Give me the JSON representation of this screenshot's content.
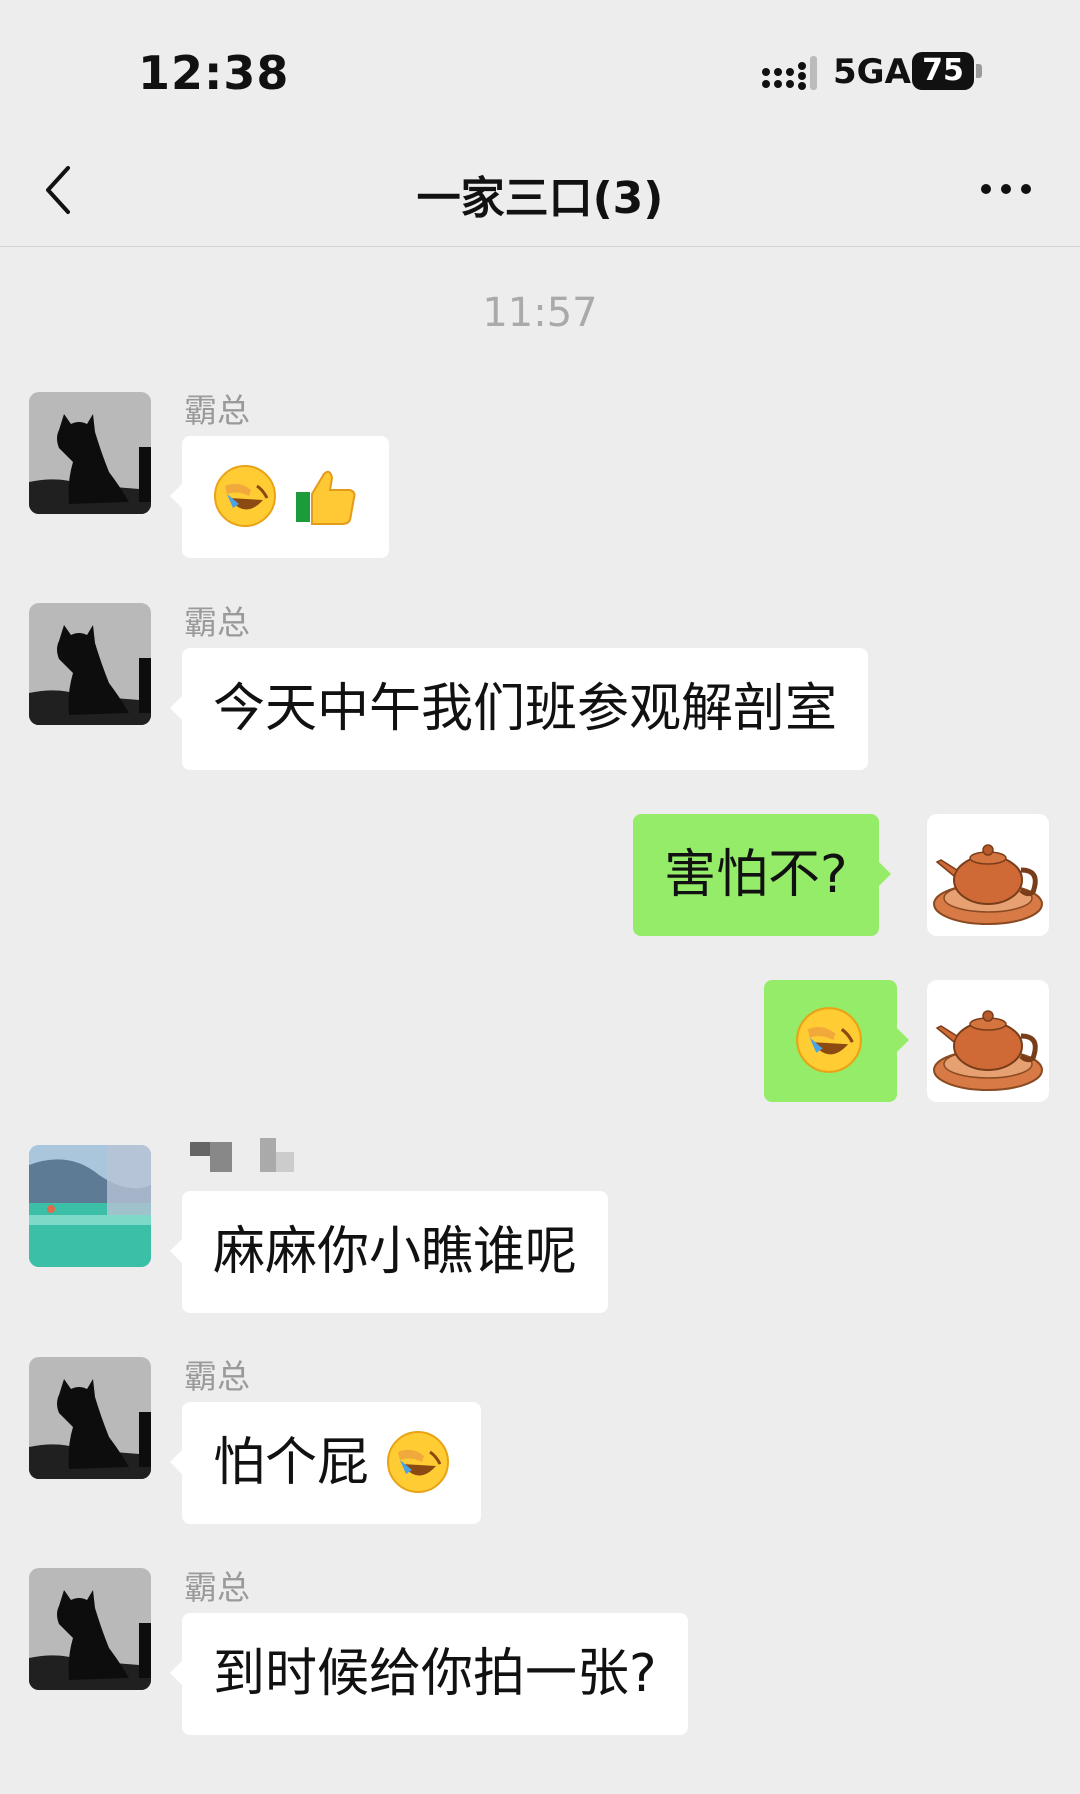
{
  "status_bar": {
    "time": "12:38",
    "network": "5GA",
    "battery": "75"
  },
  "nav": {
    "title": "一家三口(3)"
  },
  "timestamp": "11:57",
  "messages": [
    {
      "sender": "霸总",
      "text": "",
      "emojis": [
        "facepalm-laugh-emoji",
        "thumbs-up-emoji"
      ]
    },
    {
      "sender": "霸总",
      "text": "今天中午我们班参观解剖室"
    },
    {
      "sender": "",
      "text": "害怕不?"
    },
    {
      "sender": "",
      "text": "",
      "emojis": [
        "facepalm-laugh-emoji"
      ]
    },
    {
      "sender": "",
      "text": "麻麻你小瞧谁呢"
    },
    {
      "sender": "霸总",
      "text": "怕个屁",
      "emojis": [
        "facepalm-laugh-emoji"
      ]
    },
    {
      "sender": "霸总",
      "text": "到时候给你拍一张?"
    }
  ],
  "colors": {
    "background": "#ededed",
    "incoming_bubble": "#ffffff",
    "outgoing_bubble": "#95ec69",
    "name_gray": "#9a9a9a"
  }
}
